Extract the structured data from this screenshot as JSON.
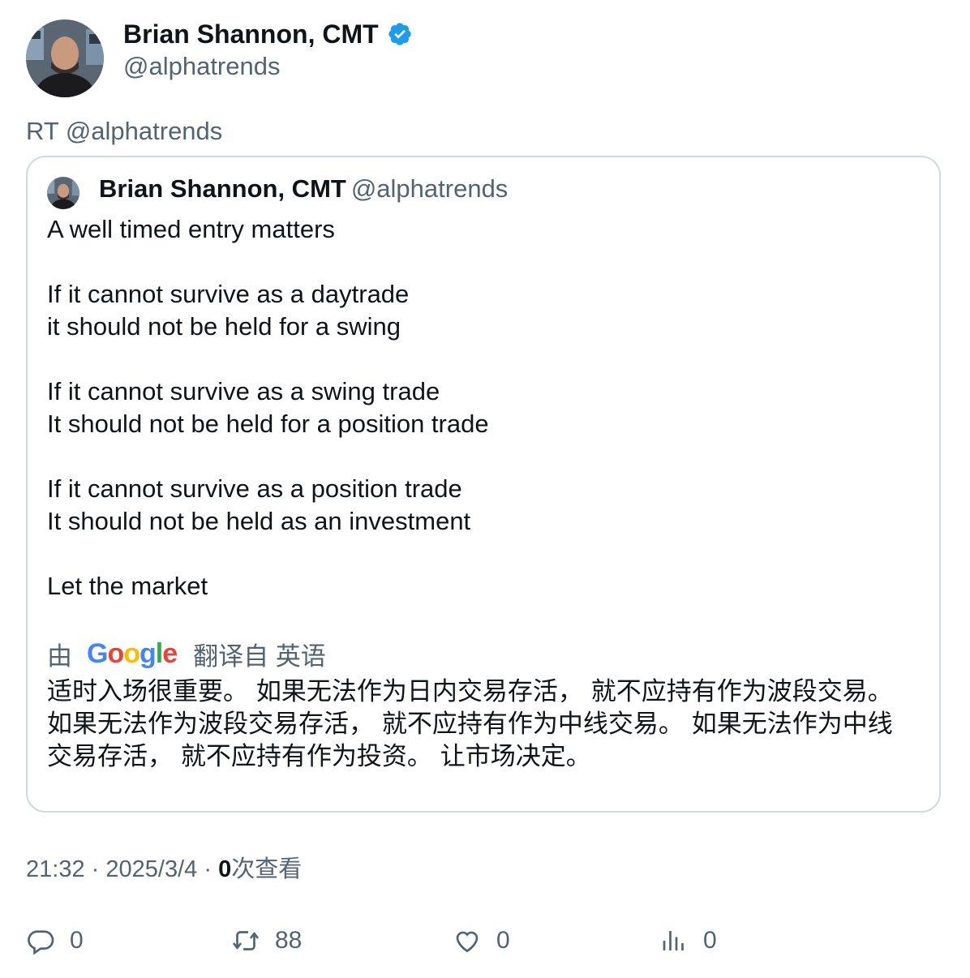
{
  "author": {
    "name": "Brian Shannon, CMT",
    "handle": "@alphatrends",
    "verified": true
  },
  "retweet_label": "RT @alphatrends",
  "quoted": {
    "name": "Brian Shannon, CMT",
    "handle": "@alphatrends",
    "lines": [
      "A well timed entry matters",
      "If it cannot survive as a daytrade",
      "it should not be held for a swing",
      "If it cannot survive as a swing trade",
      "It should not be held for a position trade",
      "If it cannot survive as a position trade",
      "It should not be held as an investment",
      "Let the market"
    ],
    "translation": {
      "prefix": "由",
      "provider": "Google",
      "suffix": "翻译自 英语",
      "lines": [
        "适时入场很重要。 如果无法作为日内交易存活， 就不应持有作为波段交易。",
        "如果无法作为波段交易存活， 就不应持有作为中线交易。 如果无法作为中线",
        "交易存活， 就不应持有作为投资。 让市场决定。"
      ]
    }
  },
  "meta": {
    "time": "21:32",
    "date": "2025/3/4",
    "separator": "·",
    "views_count": "0",
    "views_label": "次查看"
  },
  "actions": {
    "replies": "0",
    "retweets": "88",
    "likes": "0",
    "views": "0"
  },
  "colors": {
    "verified": "#1d9bf0",
    "muted": "#536471",
    "border": "#cfd9de"
  }
}
